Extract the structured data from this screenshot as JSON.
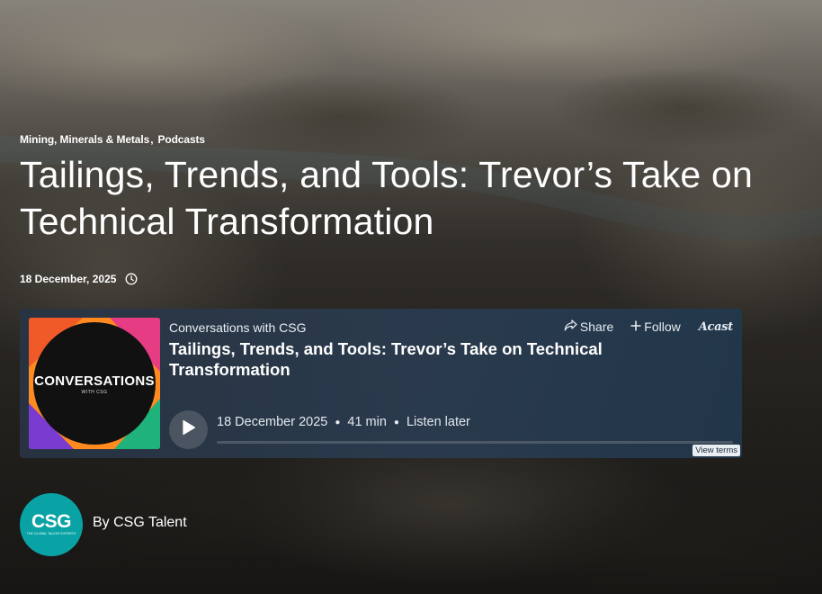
{
  "categories": [
    {
      "label": "Mining, Minerals & Metals"
    },
    {
      "label": "Podcasts"
    }
  ],
  "category_separator": ",",
  "title": "Tailings, Trends, and Tools: Trevor’s Take on Technical Transformation",
  "date": "18 December, 2025",
  "player": {
    "cover_brand": "CONVERSATIONS",
    "cover_sub": "WITH CSG",
    "show_name": "Conversations with CSG",
    "episode_title": "Tailings, Trends, and Tools: Trevor’s Take on Technical Transformation",
    "share_label": "Share",
    "follow_label": "Follow",
    "provider": "Acast",
    "episode_date": "18 December 2025",
    "duration": "41 min",
    "listen_later": "Listen later",
    "progress_fraction": 0,
    "view_terms": "View terms"
  },
  "author": {
    "avatar_text": "CSG",
    "avatar_tagline": "THE GLOBAL TALENT EXPERTS",
    "by_label": "By CSG Talent"
  },
  "colors": {
    "avatar_bg": "#0aa3a5",
    "player_bg": "#2a3c50",
    "cover_bg": "#111111"
  }
}
